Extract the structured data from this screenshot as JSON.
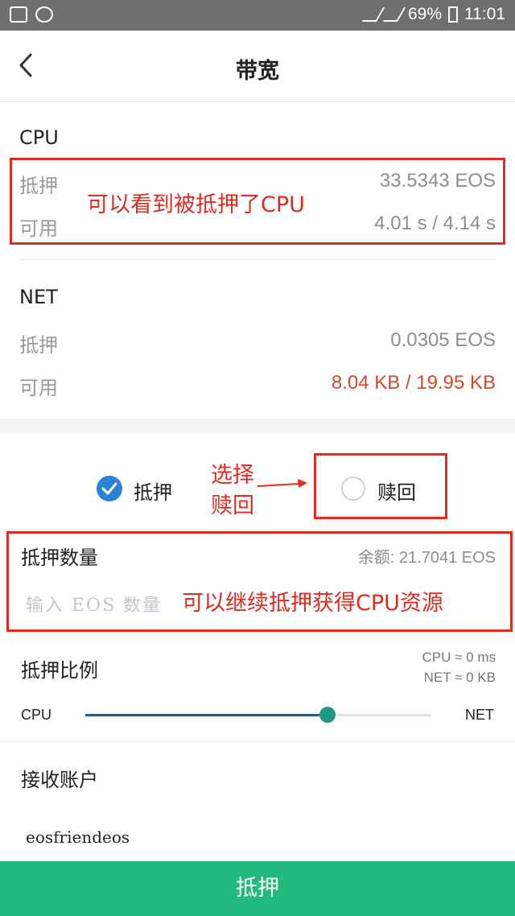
{
  "status": {
    "battery": "69%",
    "time": "11:01"
  },
  "header": {
    "title": "带宽"
  },
  "cpu": {
    "heading": "CPU",
    "staked_label": "抵押",
    "staked_value": "33.5343 EOS",
    "available_label": "可用",
    "available_value": "4.01 s / 4.14 s"
  },
  "net": {
    "heading": "NET",
    "staked_label": "抵押",
    "staked_value": "0.0305 EOS",
    "available_label": "可用",
    "available_value": "8.04 KB / 19.95 KB"
  },
  "mode": {
    "stake_label": "抵押",
    "redeem_label": "赎回",
    "selected": "抵押"
  },
  "amount": {
    "label": "抵押数量",
    "balance": "余额: 21.7041 EOS",
    "placeholder": "输入 EOS 数量"
  },
  "ratio": {
    "label": "抵押比例",
    "cpu_est": "CPU ≈ 0 ms",
    "net_est": "NET ≈ 0 KB",
    "left_label": "CPU",
    "right_label": "NET",
    "slider_fraction": 0.7
  },
  "receiver": {
    "label": "接收账户",
    "value": "eosfriendeos"
  },
  "submit": {
    "label": "抵押"
  },
  "annotations": {
    "note_cpu": "可以看到被抵押了CPU",
    "note_select_1": "选择",
    "note_select_2": "赎回",
    "note_amount": "可以继续抵押获得CPU资源"
  },
  "colors": {
    "accent": "#22ba7a",
    "checked": "#2b83d6",
    "warning": "#d24a2a",
    "annotation": "#e02b20"
  }
}
